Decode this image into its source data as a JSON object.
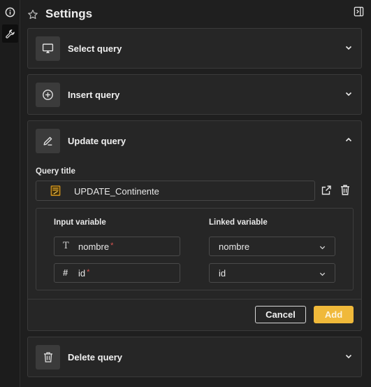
{
  "rail": {
    "icons": [
      "info-icon",
      "wrench-icon"
    ]
  },
  "header": {
    "title": "Settings"
  },
  "sections": {
    "select": {
      "title": "Select query"
    },
    "insert": {
      "title": "Insert query"
    },
    "update": {
      "title": "Update query",
      "query_title_label": "Query title",
      "query_title_value": "UPDATE_Continente",
      "input_variable_header": "Input variable",
      "linked_variable_header": "Linked variable",
      "variables": [
        {
          "type_glyph": "T",
          "name": "nombre",
          "required_mark": "*",
          "linked": "nombre"
        },
        {
          "type_glyph": "#",
          "name": "id",
          "required_mark": "*",
          "linked": "id"
        }
      ],
      "cancel_label": "Cancel",
      "add_label": "Add"
    },
    "delete": {
      "title": "Delete query"
    }
  },
  "colors": {
    "background": "#1f1f1f",
    "card": "#262626",
    "accent": "#f0b93a",
    "required": "#d9534f"
  }
}
